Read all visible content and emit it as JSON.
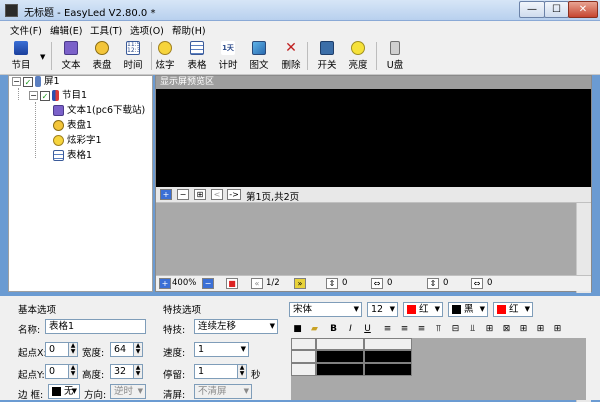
{
  "window": {
    "title_prefix": "无标题",
    "title_app": "EasyLed V2.80.0 *",
    "min": "—",
    "max": "☐",
    "close": "✕"
  },
  "menu": [
    "文件(F)",
    "编辑(E)",
    "工具(T)",
    "选项(O)",
    "帮助(H)"
  ],
  "toolbar": [
    {
      "label": "节目",
      "icon": "program-icon"
    },
    {
      "label": "文本",
      "icon": "text-icon"
    },
    {
      "label": "表盘",
      "icon": "clock-dial-icon"
    },
    {
      "label": "时间",
      "icon": "time-icon"
    },
    {
      "label": "炫字",
      "icon": "smiley-icon"
    },
    {
      "label": "表格",
      "icon": "table-icon"
    },
    {
      "label": "计时",
      "icon": "timer-icon"
    },
    {
      "label": "图文",
      "icon": "image-text-icon"
    },
    {
      "label": "删除",
      "icon": "delete-icon"
    },
    {
      "label": "开关",
      "icon": "power-icon"
    },
    {
      "label": "亮度",
      "icon": "brightness-icon"
    },
    {
      "label": "U盘",
      "icon": "usb-icon"
    }
  ],
  "tree": {
    "screen": "屏1",
    "program": "节目1",
    "items": [
      {
        "label": "文本1(pc6下载站)",
        "icon": "text-icon"
      },
      {
        "label": "表盘1",
        "icon": "clock-dial-icon"
      },
      {
        "label": "炫彩字1",
        "icon": "smiley-icon"
      },
      {
        "label": "表格1",
        "icon": "table-icon"
      }
    ]
  },
  "preview": {
    "title": "显示屏预览区",
    "page_text": "第1页,共2页",
    "btns": [
      "+",
      "−",
      "⊞",
      "<",
      "->"
    ],
    "zoom": "400%",
    "page": "1/2",
    "status_values": [
      "0",
      "0",
      "0",
      "0"
    ]
  },
  "basic": {
    "title": "基本选项",
    "name_label": "名称:",
    "name_value": "表格1",
    "x_label": "起点X:",
    "x_value": "0",
    "w_label": "宽度:",
    "w_value": "64",
    "y_label": "起点Y:",
    "y_value": "0",
    "h_label": "高度:",
    "h_value": "32",
    "border_label": "边 框:",
    "border_value": "无",
    "dir_label": "方向:",
    "dir_value": "逆时"
  },
  "effects": {
    "title": "特技选项",
    "effect_label": "特技:",
    "effect_value": "连续左移",
    "speed_label": "速度:",
    "speed_value": "1",
    "stay_label": "停留:",
    "stay_value": "1",
    "stay_unit": "秒",
    "clear_label": "清屏:",
    "clear_value": "不清屏"
  },
  "format": {
    "font": "宋体",
    "size": "12",
    "color1": "红",
    "color2": "黑",
    "color3": "红",
    "bold": "B",
    "italic": "I",
    "underline": "U"
  },
  "colors": {
    "red": "#ff0000",
    "black": "#000000",
    "accent": "#6b9bd2"
  }
}
